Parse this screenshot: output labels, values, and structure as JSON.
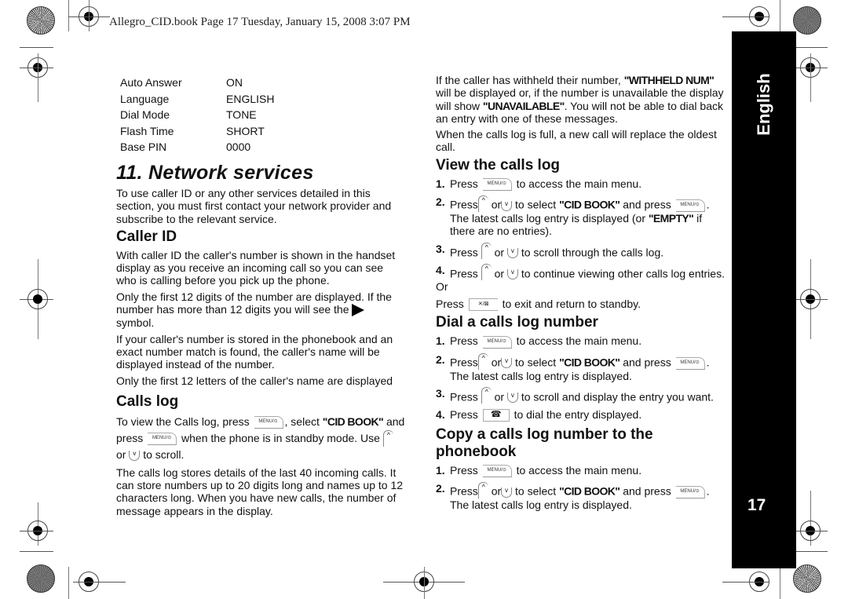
{
  "header": {
    "text": "Allegro_CID.book  Page 17  Tuesday, January 15, 2008  3:07 PM"
  },
  "settings": [
    {
      "key": "Auto Answer",
      "value": "ON"
    },
    {
      "key": "Language",
      "value": "ENGLISH"
    },
    {
      "key": "Dial Mode",
      "value": "TONE"
    },
    {
      "key": "Flash Time",
      "value": "SHORT"
    },
    {
      "key": "Base PIN",
      "value": "0000"
    }
  ],
  "section": {
    "title": "11. Network services",
    "intro": "To use caller ID or any other services detailed in this section, you must first contact your network provider and subscribe to the relevant service."
  },
  "caller_id": {
    "title": "Caller ID",
    "p1": "With caller ID the caller's number is shown in the handset display as you receive an incoming call so you can see who is calling before you pick up the phone.",
    "p2a": "Only the first 12 digits of the number are displayed. If the number has more than 12 digits you will see the",
    "p2b": "symbol.",
    "p3": "If your caller's number is stored in the phonebook and an exact number match is found, the caller's name will be displayed instead of the number.",
    "p4": "Only the first 12 letters of the caller's name are displayed"
  },
  "calls_log": {
    "title": "Calls log",
    "t1": "To view the Calls log, press",
    "t2": ", select",
    "cid_book": "\"CID BOOK\"",
    "t3": "and press",
    "t4": "when the phone is in standby mode. Use",
    "or": "or",
    "t5": "to scroll.",
    "p2": "The calls log stores details of the last 40 incoming calls. It can store numbers up to 20 digits long and names up to 12 characters long. When you have new calls, the number of message appears in the display."
  },
  "right": {
    "p1a": "If the caller has withheld their number,",
    "withheld": "\"WITHHELD NUM\"",
    "p1b": "will be displayed or, if the number is unavailable the display will show",
    "unavailable": "\"UNAVAILABLE\"",
    "p1c": ". You will not be able to dial back an entry with one of these messages.",
    "p2": "When the calls log is full, a new call will replace the oldest call."
  },
  "view_log": {
    "title": "View the calls log",
    "s1a": "Press",
    "s1b": "to access the main menu.",
    "s2a": "Press",
    "s2or": "or",
    "s2b": "to select",
    "s2c": "and press",
    "s2d": ". The latest calls log entry is displayed (or",
    "empty": "\"EMPTY\"",
    "s2e": "if there are no entries).",
    "s3a": "Press",
    "s3b": "to scroll through the calls log.",
    "s4a": "Press",
    "s4b": "to continue viewing other calls log entries.",
    "or_line": "Or",
    "exit_a": "Press",
    "exit_b": "to exit and return to standby."
  },
  "dial_log": {
    "title": "Dial a calls log number",
    "s1b": "to access the main menu.",
    "s2d": ". The latest calls log entry is displayed.",
    "s3b": "to scroll and display the entry you want.",
    "s4b": "to dial the entry displayed."
  },
  "copy_log": {
    "title": "Copy a calls log number to the phonebook",
    "s1b": "to access the main menu.",
    "s2d": ". The latest calls log entry is displayed."
  },
  "keys": {
    "menu": "MENU/⊙",
    "end": "✕/⊠",
    "talk": "☎"
  },
  "steps": {
    "n1": "1.",
    "n2": "2.",
    "n3": "3.",
    "n4": "4.",
    "press": "Press",
    "or": "or",
    "to_select": "to select",
    "and_press": "and press"
  },
  "tab": {
    "language": "English",
    "page": "17"
  }
}
